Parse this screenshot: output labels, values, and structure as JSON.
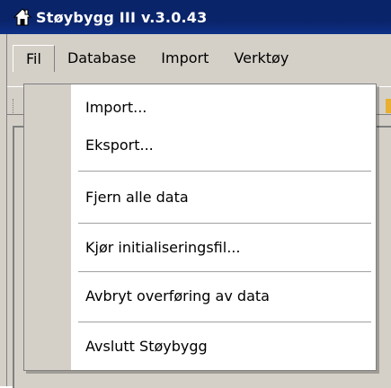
{
  "window": {
    "title": "Støybygg III v.3.0.43",
    "icon": "house-icon"
  },
  "menubar": {
    "items": [
      {
        "label": "Fil",
        "active": true
      },
      {
        "label": "Database"
      },
      {
        "label": "Import"
      },
      {
        "label": "Verktøy"
      }
    ]
  },
  "file_menu": {
    "items": [
      {
        "label": "Import..."
      },
      {
        "label": "Eksport..."
      },
      {
        "label": "Fjern alle data"
      },
      {
        "label": "Kjør initialiseringsfil..."
      },
      {
        "label": "Avbryt overføring av data"
      },
      {
        "label": "Avslutt Støybygg"
      }
    ]
  },
  "colors": {
    "titlebar": "#0a246a",
    "chrome": "#d4d0c8",
    "menu_bg": "#ffffff"
  }
}
